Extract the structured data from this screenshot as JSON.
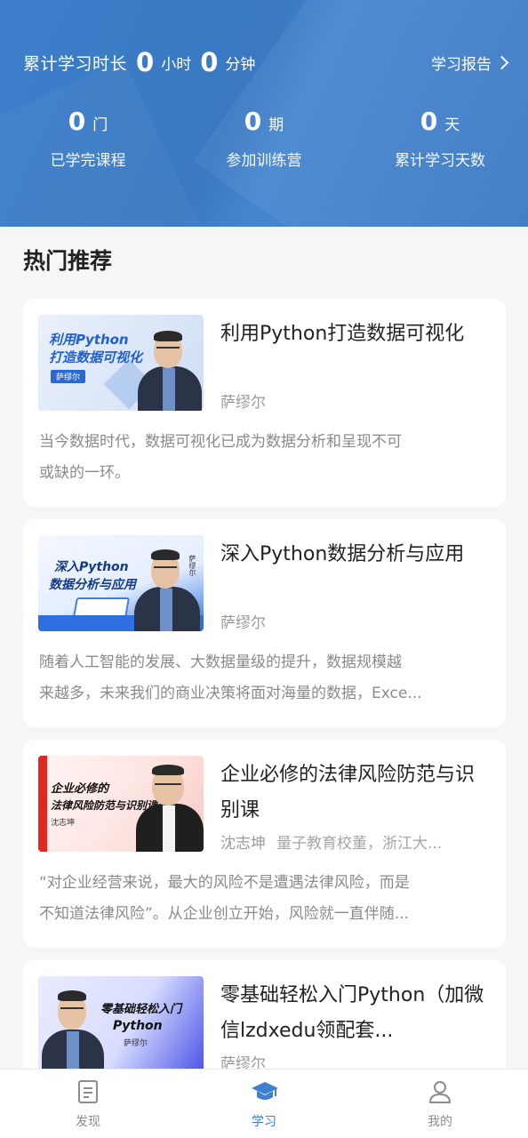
{
  "header": {
    "total_label": "累计学习时长",
    "hours": "0",
    "hours_unit": "小时",
    "minutes": "0",
    "minutes_unit": "分钟",
    "report_label": "学习报告",
    "stats": [
      {
        "value": "0",
        "unit": "门",
        "label": "已学完课程"
      },
      {
        "value": "0",
        "unit": "期",
        "label": "参加训练营"
      },
      {
        "value": "0",
        "unit": "天",
        "label": "累计学习天数"
      }
    ]
  },
  "section_title": "热门推荐",
  "courses": [
    {
      "title": "利用Python打造数据可视化",
      "author": "萨缪尔",
      "author_extra": "",
      "desc_line1": "当今数据时代，数据可视化已成为数据分析和呈现不可",
      "desc_line2": "或缺的一环。",
      "thumb_text_1": "利用Python",
      "thumb_text_2": "打造数据可视化",
      "thumb_name": "萨缪尔"
    },
    {
      "title": "深入Python数据分析与应用",
      "author": "萨缪尔",
      "author_extra": "",
      "desc_line1": "随着人工智能的发展、大数据量级的提升，数据规模越",
      "desc_line2": "来越多，未来我们的商业决策将面对海量的数据，Exce...",
      "thumb_text_1": "深入Python",
      "thumb_text_2": "数据分析与应用",
      "thumb_name": "萨缪尔"
    },
    {
      "title": "企业必修的法律风险防范与识别课",
      "author": "沈志坤",
      "author_extra": "量子教育校董，浙江大...",
      "desc_line1": "“对企业经营来说，最大的风险不是遭遇法律风险，而是",
      "desc_line2": "不知道法律风险”。从企业创立开始，风险就一直伴随...",
      "thumb_text_1": "企业必修的",
      "thumb_text_2": "法律风险防范与识别课",
      "thumb_name": "沈志坤"
    },
    {
      "title": "零基础轻松入门Python（加微信lzdxedu领配套...",
      "author": "萨缪尔",
      "author_extra": "",
      "desc_line1": "",
      "desc_line2": "",
      "thumb_text_1": "零基础轻松入门",
      "thumb_text_2": "Python",
      "thumb_name": "萨缪尔"
    }
  ],
  "nav": [
    {
      "label": "发现",
      "icon": "document-icon",
      "active": false
    },
    {
      "label": "学习",
      "icon": "graduation-cap-icon",
      "active": true
    },
    {
      "label": "我的",
      "icon": "person-icon",
      "active": false
    }
  ],
  "colors": {
    "header_blue": "#3a78c2",
    "active_blue": "#3d7fd0"
  }
}
